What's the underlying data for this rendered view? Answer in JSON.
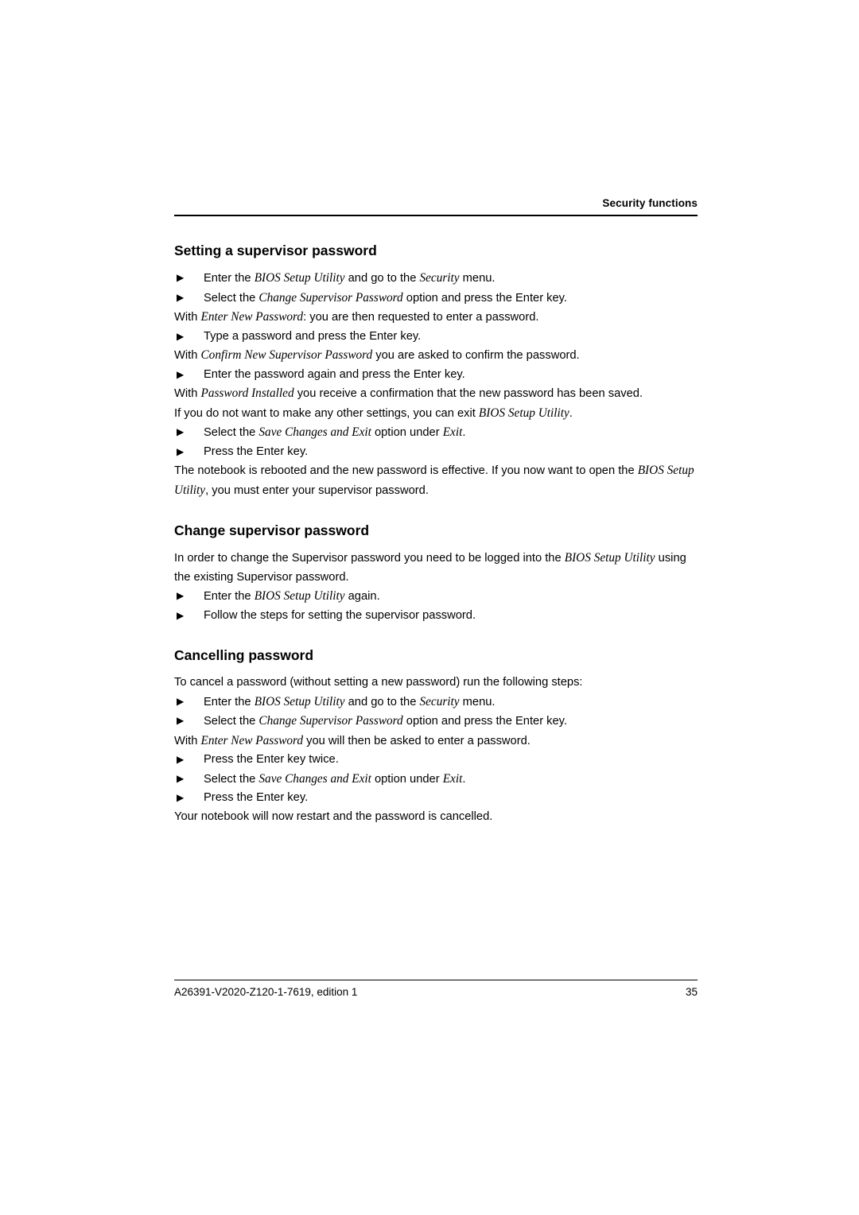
{
  "header": {
    "title": "Security functions"
  },
  "footer": {
    "document_id": "A26391-V2020-Z120-1-7619, edition 1",
    "page_number": "35"
  },
  "icons": {
    "bullet": "▶"
  },
  "sections": [
    {
      "heading": "Setting a supervisor password",
      "blocks": [
        {
          "type": "bullet",
          "parts": [
            {
              "t": "Enter the ",
              "i": false
            },
            {
              "t": "BIOS Setup Utility",
              "i": true
            },
            {
              "t": " and go to the ",
              "i": false
            },
            {
              "t": "Security",
              "i": true
            },
            {
              "t": " menu.",
              "i": false
            }
          ]
        },
        {
          "type": "bullet",
          "parts": [
            {
              "t": "Select the ",
              "i": false
            },
            {
              "t": "Change Supervisor Password",
              "i": true
            },
            {
              "t": " option and press the Enter key.",
              "i": false
            }
          ]
        },
        {
          "type": "para",
          "parts": [
            {
              "t": "With ",
              "i": false
            },
            {
              "t": "Enter New Password",
              "i": true
            },
            {
              "t": ": you are then requested to enter a password.",
              "i": false
            }
          ]
        },
        {
          "type": "bullet",
          "parts": [
            {
              "t": "Type a password and press the Enter key.",
              "i": false
            }
          ]
        },
        {
          "type": "para",
          "parts": [
            {
              "t": "With ",
              "i": false
            },
            {
              "t": "Confirm New Supervisor Password",
              "i": true
            },
            {
              "t": " you are asked to confirm the password.",
              "i": false
            }
          ]
        },
        {
          "type": "bullet",
          "parts": [
            {
              "t": "Enter the password again and press the Enter key.",
              "i": false
            }
          ]
        },
        {
          "type": "para",
          "parts": [
            {
              "t": "With ",
              "i": false
            },
            {
              "t": "Password Installed",
              "i": true
            },
            {
              "t": " you receive a confirmation that the new password has been saved.",
              "i": false
            }
          ]
        },
        {
          "type": "para",
          "parts": [
            {
              "t": "If you do not want to make any other settings, you can exit ",
              "i": false
            },
            {
              "t": "BIOS Setup Utility",
              "i": true
            },
            {
              "t": ".",
              "i": false
            }
          ]
        },
        {
          "type": "bullet",
          "parts": [
            {
              "t": "Select the ",
              "i": false
            },
            {
              "t": "Save Changes and Exit",
              "i": true
            },
            {
              "t": " option under ",
              "i": false
            },
            {
              "t": "Exit",
              "i": true
            },
            {
              "t": ".",
              "i": false
            }
          ]
        },
        {
          "type": "bullet",
          "parts": [
            {
              "t": "Press the Enter key.",
              "i": false
            }
          ]
        },
        {
          "type": "para",
          "parts": [
            {
              "t": "The notebook is rebooted and the new password is effective. If you now want to open the ",
              "i": false
            },
            {
              "t": "BIOS Setup",
              "i": true
            }
          ]
        },
        {
          "type": "para",
          "parts": [
            {
              "t": "Utility",
              "i": true
            },
            {
              "t": ", you must enter your supervisor password.",
              "i": false
            }
          ]
        }
      ]
    },
    {
      "heading": "Change supervisor password",
      "blocks": [
        {
          "type": "para",
          "parts": [
            {
              "t": "In order to change the Supervisor password you need to be logged into the ",
              "i": false
            },
            {
              "t": "BIOS Setup Utility",
              "i": true
            },
            {
              "t": " using",
              "i": false
            }
          ]
        },
        {
          "type": "para",
          "parts": [
            {
              "t": "the existing Supervisor password.",
              "i": false
            }
          ]
        },
        {
          "type": "bullet",
          "parts": [
            {
              "t": "Enter the ",
              "i": false
            },
            {
              "t": "BIOS Setup Utility",
              "i": true
            },
            {
              "t": " again.",
              "i": false
            }
          ]
        },
        {
          "type": "bullet",
          "parts": [
            {
              "t": "Follow the steps for setting the supervisor password.",
              "i": false
            }
          ]
        }
      ]
    },
    {
      "heading": "Cancelling password",
      "blocks": [
        {
          "type": "para",
          "parts": [
            {
              "t": "To cancel a password (without setting a new password) run the following steps:",
              "i": false
            }
          ]
        },
        {
          "type": "bullet",
          "parts": [
            {
              "t": "Enter the ",
              "i": false
            },
            {
              "t": "BIOS Setup Utility",
              "i": true
            },
            {
              "t": " and go to the ",
              "i": false
            },
            {
              "t": "Security",
              "i": true
            },
            {
              "t": " menu.",
              "i": false
            }
          ]
        },
        {
          "type": "bullet",
          "parts": [
            {
              "t": "Select the ",
              "i": false
            },
            {
              "t": "Change Supervisor Password",
              "i": true
            },
            {
              "t": " option and press the Enter key.",
              "i": false
            }
          ]
        },
        {
          "type": "para",
          "parts": [
            {
              "t": "With ",
              "i": false
            },
            {
              "t": "Enter New Password",
              "i": true
            },
            {
              "t": " you will then be asked to enter a password.",
              "i": false
            }
          ]
        },
        {
          "type": "bullet",
          "parts": [
            {
              "t": "Press the Enter key twice.",
              "i": false
            }
          ]
        },
        {
          "type": "bullet",
          "parts": [
            {
              "t": "Select the ",
              "i": false
            },
            {
              "t": "Save Changes and Exit",
              "i": true
            },
            {
              "t": " option under ",
              "i": false
            },
            {
              "t": "Exit",
              "i": true
            },
            {
              "t": ".",
              "i": false
            }
          ]
        },
        {
          "type": "bullet",
          "parts": [
            {
              "t": "Press the Enter key.",
              "i": false
            }
          ]
        },
        {
          "type": "para",
          "parts": [
            {
              "t": "Your notebook will now restart and the password is cancelled.",
              "i": false
            }
          ]
        }
      ]
    }
  ]
}
